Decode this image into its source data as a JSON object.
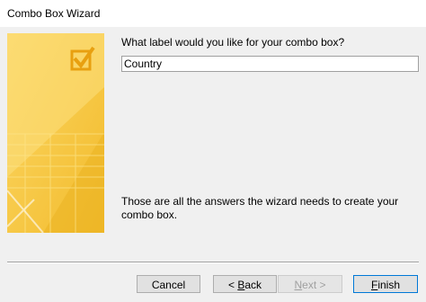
{
  "window": {
    "title": "Combo Box Wizard"
  },
  "wizard": {
    "question": "What label would you like for your combo box?",
    "label_value": "Country",
    "summary": "Those are all the answers the wizard needs to create your combo box."
  },
  "buttons": {
    "cancel": "Cancel",
    "back_prefix": "< ",
    "back_mnemonic": "B",
    "back_suffix": "ack",
    "next_prefix": "",
    "next_mnemonic": "N",
    "next_suffix": "ext >",
    "next_enabled": false,
    "finish_mnemonic": "F",
    "finish_suffix": "inish"
  },
  "colors": {
    "art_base": "#f7c948",
    "art_light": "#fde58a",
    "art_dark": "#eab21f",
    "default_button_border": "#0078d7"
  }
}
